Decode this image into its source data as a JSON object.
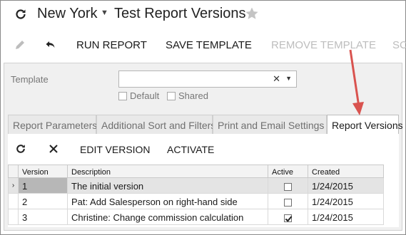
{
  "header": {
    "company": "New York",
    "screen_title": "Test Report Versions"
  },
  "toolbar": {
    "run_report": "RUN REPORT",
    "save_template": "SAVE TEMPLATE",
    "remove_template": "REMOVE TEMPLATE",
    "overflow": "SC"
  },
  "form": {
    "template_label": "Template",
    "template_value": "",
    "default_label": "Default",
    "shared_label": "Shared"
  },
  "tabs": [
    {
      "label": "Report Parameters"
    },
    {
      "label": "Additional Sort and Filters"
    },
    {
      "label": "Print and Email Settings"
    },
    {
      "label": "Report Versions"
    }
  ],
  "grid_toolbar": {
    "edit_version": "EDIT VERSION",
    "activate": "ACTIVATE"
  },
  "grid": {
    "columns": [
      "Version",
      "Description",
      "Active",
      "Created"
    ],
    "rows": [
      {
        "version": "1",
        "description": "The initial version",
        "active": false,
        "created": "1/24/2015"
      },
      {
        "version": "2",
        "description": "Pat: Add Salesperson on right-hand side",
        "active": false,
        "created": "1/24/2015"
      },
      {
        "version": "3",
        "description": "Christine: Change commission calculation",
        "active": true,
        "created": "1/24/2015"
      }
    ]
  },
  "colors": {
    "annotation_arrow": "#d9534f",
    "panel_background": "#f0f0f0",
    "selected_row": "#e4e4e4"
  },
  "icons": {
    "refresh": "refresh-icon",
    "favorite": "star-icon",
    "edit": "pencil-icon",
    "undo": "undo-icon",
    "delete": "close-icon"
  }
}
